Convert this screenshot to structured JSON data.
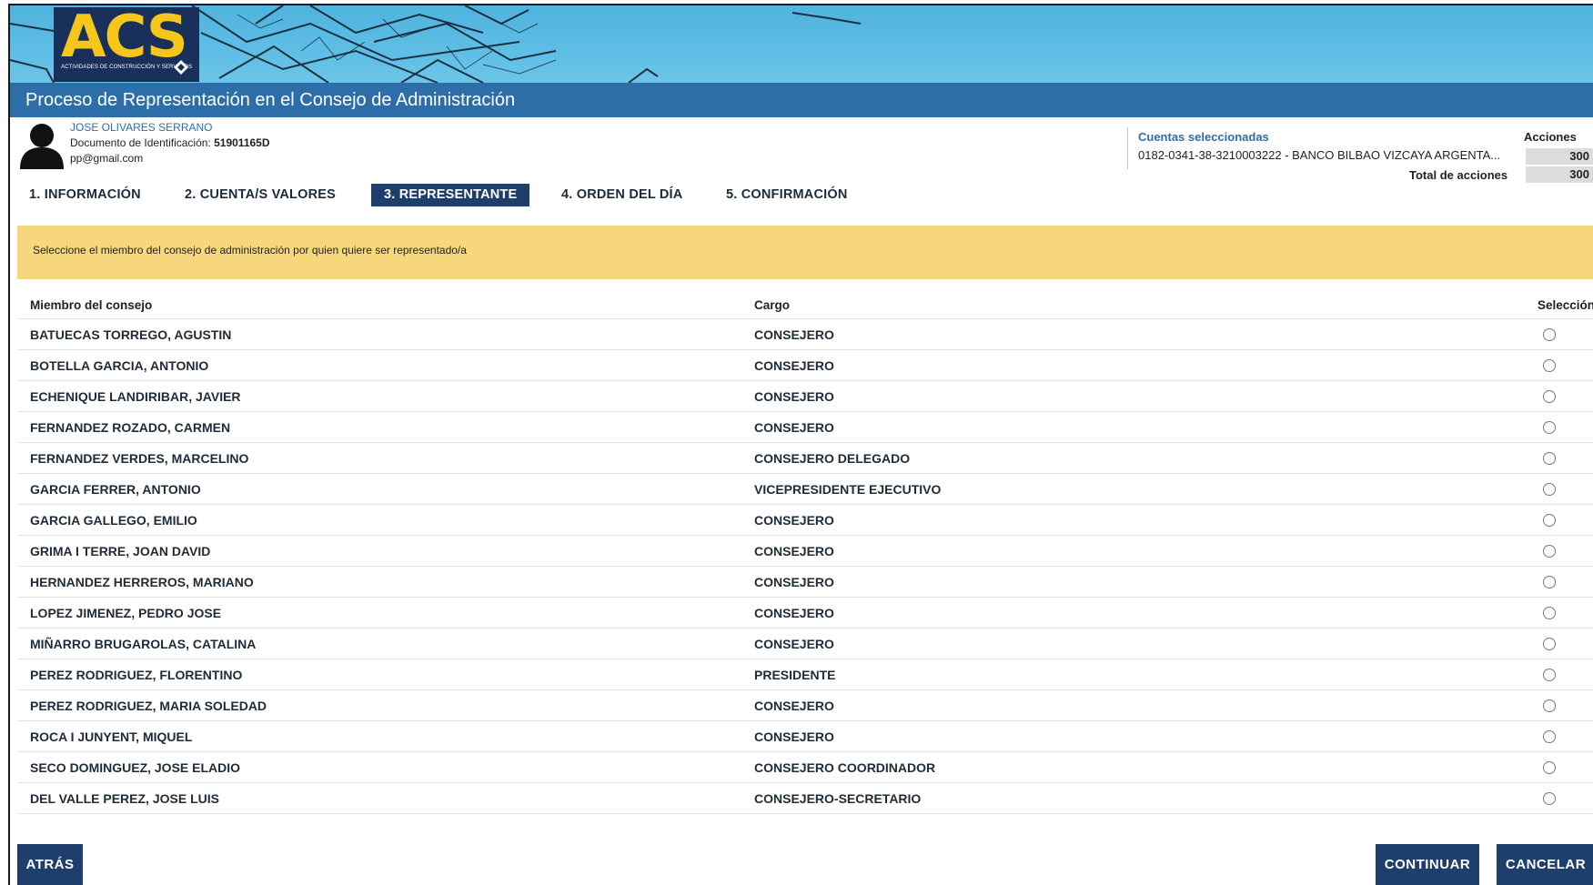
{
  "logo": {
    "text": "ACS",
    "subtitle": "ACTIVIDADES DE CONSTRUCCIÓN Y SERVICIOS"
  },
  "page_title": "Proceso de Representación en el Consejo de Administración",
  "user": {
    "name": "JOSE OLIVARES SERRANO",
    "doc_label": "Documento de Identificación:",
    "doc_value": "51901165D",
    "email": "pp@gmail.com"
  },
  "accounts": {
    "title": "Cuentas seleccionadas",
    "line": "0182-0341-38-3210003222 - BANCO BILBAO VIZCAYA ARGENTA...",
    "acciones_label": "Acciones",
    "acciones_value": "300",
    "total_label": "Total de acciones",
    "total_value": "300"
  },
  "tabs": [
    {
      "label": "1. INFORMACIÓN",
      "active": false
    },
    {
      "label": "2. CUENTA/S VALORES",
      "active": false
    },
    {
      "label": "3. REPRESENTANTE",
      "active": true
    },
    {
      "label": "4. ORDEN DEL DÍA",
      "active": false
    },
    {
      "label": "5. CONFIRMACIÓN",
      "active": false
    }
  ],
  "notice": "Seleccione el miembro del consejo de administración por quien quiere ser representado/a",
  "table": {
    "headers": {
      "member": "Miembro del consejo",
      "cargo": "Cargo",
      "select": "Selección"
    },
    "rows": [
      {
        "name": "BATUECAS TORREGO, AGUSTIN",
        "cargo": "CONSEJERO"
      },
      {
        "name": "BOTELLA GARCIA, ANTONIO",
        "cargo": "CONSEJERO"
      },
      {
        "name": "ECHENIQUE LANDIRIBAR, JAVIER",
        "cargo": "CONSEJERO"
      },
      {
        "name": "FERNANDEZ ROZADO, CARMEN",
        "cargo": "CONSEJERO"
      },
      {
        "name": "FERNANDEZ VERDES, MARCELINO",
        "cargo": "CONSEJERO DELEGADO"
      },
      {
        "name": "GARCIA FERRER, ANTONIO",
        "cargo": "VICEPRESIDENTE EJECUTIVO"
      },
      {
        "name": "GARCIA GALLEGO, EMILIO",
        "cargo": "CONSEJERO"
      },
      {
        "name": "GRIMA I TERRE, JOAN DAVID",
        "cargo": "CONSEJERO"
      },
      {
        "name": "HERNANDEZ HERREROS, MARIANO",
        "cargo": "CONSEJERO"
      },
      {
        "name": "LOPEZ JIMENEZ, PEDRO JOSE",
        "cargo": "CONSEJERO"
      },
      {
        "name": "MIÑARRO BRUGAROLAS, CATALINA",
        "cargo": "CONSEJERO"
      },
      {
        "name": "PEREZ RODRIGUEZ, FLORENTINO",
        "cargo": "PRESIDENTE"
      },
      {
        "name": "PEREZ RODRIGUEZ, MARIA SOLEDAD",
        "cargo": "CONSEJERO"
      },
      {
        "name": "ROCA I JUNYENT, MIQUEL",
        "cargo": "CONSEJERO"
      },
      {
        "name": "SECO DOMINGUEZ, JOSE ELADIO",
        "cargo": "CONSEJERO COORDINADOR"
      },
      {
        "name": "DEL VALLE PEREZ, JOSE LUIS",
        "cargo": "CONSEJERO-SECRETARIO"
      }
    ]
  },
  "buttons": {
    "back": "ATRÁS",
    "continue": "CONTINUAR",
    "cancel": "CANCELAR"
  },
  "colors": {
    "banner_sky": "#5dbde5",
    "title_bar": "#2e6ea8",
    "active_tab": "#1e3f6b",
    "notice_bg": "#f6d77c",
    "logo_bg": "#19305a",
    "logo_text": "#f6c61b",
    "button_bg": "#1e3f6b"
  },
  "icons": {
    "avatar": "user-silhouette-icon",
    "radio": "radio-unchecked-icon",
    "logo_mark": "diamond-icon"
  }
}
